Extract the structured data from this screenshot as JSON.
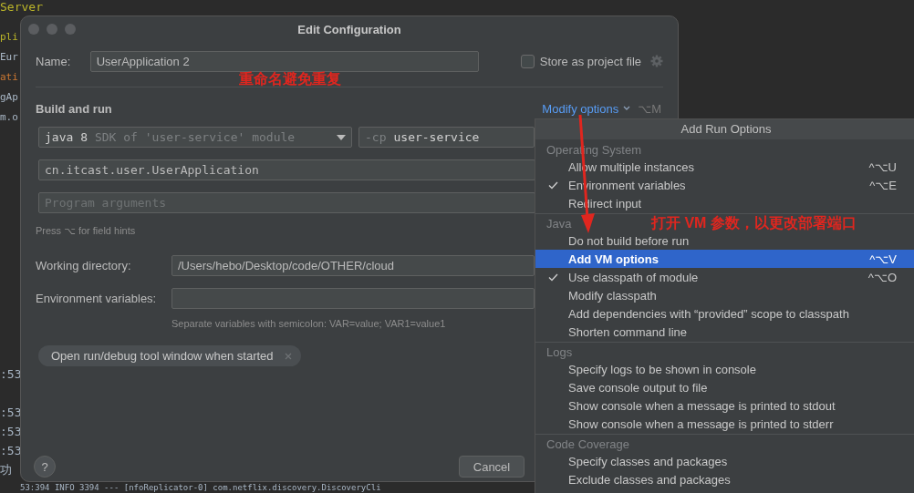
{
  "editor": {
    "top_lines": [
      {
        "text": "Server",
        "kind": "yellow"
      },
      {
        "text": "pli",
        "kind": "yellow"
      },
      {
        "text": "Eur",
        "kind": "plain"
      },
      {
        "text": "ati",
        "kind": "orange"
      },
      {
        "text": "gAp",
        "kind": "plain"
      },
      {
        "text": "m.o",
        "kind": "plain"
      }
    ],
    "log_lines": [
      ":53",
      ":53",
      ":53",
      ":53",
      "功"
    ],
    "bottom_line": "53:394  INFO 3394 --- [nfoReplicator-0] com.netflix.discovery.DiscoveryCli"
  },
  "dialog": {
    "title": "Edit Configuration",
    "name": {
      "label": "Name:",
      "value": "UserApplication 2"
    },
    "store_as_project_file": {
      "label": "Store as project file",
      "checked": false
    },
    "section_title": "Build and run",
    "modify_options": {
      "label": "Modify options",
      "shortcut": "⌥M"
    },
    "jre": {
      "value": "java 8",
      "hint": "SDK of 'user-service' module"
    },
    "classpath": {
      "flag": "-cp",
      "value": "user-service"
    },
    "main_class": "cn.itcast.user.UserApplication",
    "program_arguments": {
      "placeholder": "Program arguments"
    },
    "field_hint": "Press ⌥ for field hints",
    "working_directory": {
      "label": "Working directory:",
      "value": "/Users/hebo/Desktop/code/OTHER/cloud"
    },
    "environment_variables": {
      "label": "Environment variables:",
      "hint": "Separate variables with semicolon: VAR=value; VAR1=value1"
    },
    "option_chip": "Open run/debug tool window when started",
    "help": "?",
    "buttons": [
      "Cancel"
    ]
  },
  "menu": {
    "title": "Add Run Options",
    "groups": [
      {
        "title": "Operating System",
        "items": [
          {
            "label": "Allow multiple instances",
            "checked": false,
            "selected": false,
            "shortcut": "^⌥U"
          },
          {
            "label": "Environment variables",
            "checked": true,
            "selected": false,
            "shortcut": "^⌥E"
          },
          {
            "label": "Redirect input",
            "checked": false,
            "selected": false
          }
        ]
      },
      {
        "title": "Java",
        "items": [
          {
            "label": "Do not build before run",
            "checked": false,
            "selected": false
          },
          {
            "label": "Add VM options",
            "checked": false,
            "selected": true,
            "shortcut": "^⌥V"
          },
          {
            "label": "Use classpath of module",
            "checked": true,
            "selected": false,
            "shortcut": "^⌥O"
          },
          {
            "label": "Modify classpath",
            "checked": false,
            "selected": false
          },
          {
            "label": "Add dependencies with “provided” scope to classpath",
            "checked": false,
            "selected": false
          },
          {
            "label": "Shorten command line",
            "checked": false,
            "selected": false
          }
        ]
      },
      {
        "title": "Logs",
        "items": [
          {
            "label": "Specify logs to be shown in console",
            "checked": false,
            "selected": false
          },
          {
            "label": "Save console output to file",
            "checked": false,
            "selected": false
          },
          {
            "label": "Show console when a message is printed to stdout",
            "checked": false,
            "selected": false
          },
          {
            "label": "Show console when a message is printed to stderr",
            "checked": false,
            "selected": false
          }
        ]
      },
      {
        "title": "Code Coverage",
        "items": [
          {
            "label": "Specify classes and packages",
            "checked": false,
            "selected": false
          },
          {
            "label": "Exclude classes and packages",
            "checked": false,
            "selected": false
          }
        ]
      }
    ]
  },
  "annotations": [
    {
      "text": "重命名避免重复",
      "kind": "name"
    },
    {
      "text": "打开 VM 参数，以更改部署端口",
      "kind": "menu"
    }
  ]
}
